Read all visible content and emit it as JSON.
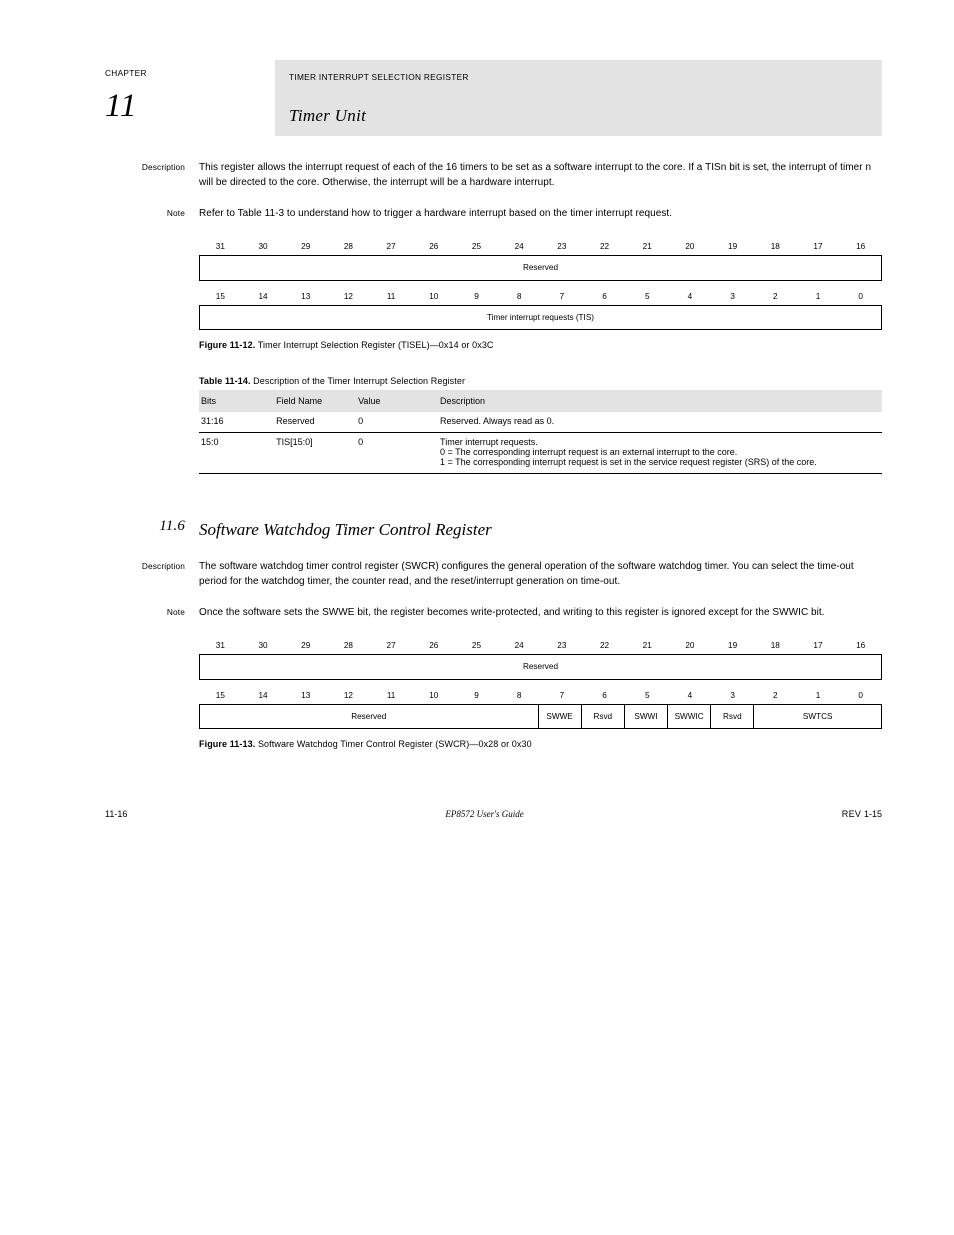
{
  "runhead": {
    "chapter_label": "CHAPTER",
    "chapter_num": "11",
    "sub": "TIMER INTERRUPT SELECTION REGISTER",
    "title": "Timer Unit"
  },
  "intro": {
    "desc_label": "Description",
    "desc_body": "This register allows the interrupt request of each of the 16 timers to be set as a software interrupt to the core. If a TISn bit is set, the interrupt of timer n will be directed to the core. Otherwise, the interrupt will be a hardware interrupt.",
    "note_label": "Note",
    "note_body": "Refer to Table 11-3 to understand how to trigger a hardware interrupt based on the timer interrupt request."
  },
  "fig1": {
    "bits_hi": [
      "31",
      "30",
      "29",
      "28",
      "27",
      "26",
      "25",
      "24",
      "23",
      "22",
      "21",
      "20",
      "19",
      "18",
      "17",
      "16"
    ],
    "field_hi": "Reserved",
    "bits_lo": [
      "15",
      "14",
      "13",
      "12",
      "11",
      "10",
      "9",
      "8",
      "7",
      "6",
      "5",
      "4",
      "3",
      "2",
      "1",
      "0"
    ],
    "field_lo": "Timer interrupt requests (TIS)",
    "cap_num": "Figure 11-12.",
    "cap_txt": "Timer Interrupt Selection Register (TISEL)—0x14 or 0x3C"
  },
  "tbl1": {
    "cap_num": "Table 11-14.",
    "cap_txt": "Description of the Timer Interrupt Selection Register",
    "h_bits": "Bits",
    "h_field": "Field Name",
    "h_value": "Value",
    "h_desc": "Description",
    "r0": {
      "bits": "31:16",
      "field": "Reserved",
      "value": "0",
      "desc": "Reserved. Always read as 0."
    },
    "r1": {
      "bits": "15:0",
      "field": "TIS[15:0]",
      "value": "0",
      "desc0": "Timer interrupt requests.",
      "desc1": "0 = The corresponding interrupt request is an external interrupt to the core.",
      "desc2": "1 = The corresponding interrupt request is set in the service request register (SRS) of the core."
    }
  },
  "sec2": {
    "title_ref": "11.6",
    "title_txt": "Software Watchdog Timer Control Register",
    "desc_label": "Description",
    "desc_body": "The software watchdog timer control register (SWCR) configures the general operation of the software watchdog timer. You can select the time-out period for the watchdog timer, the counter read, and the reset/interrupt generation on time-out.",
    "note_label": "Note",
    "note_body": "Once the software sets the SWWE bit, the register becomes write-protected, and writing to this register is ignored except for the SWWIC bit."
  },
  "fig2": {
    "bits_hi": [
      "31",
      "30",
      "29",
      "28",
      "27",
      "26",
      "25",
      "24",
      "23",
      "22",
      "21",
      "20",
      "19",
      "18",
      "17",
      "16"
    ],
    "field_hi": "Reserved",
    "bits_lo": [
      "15",
      "14",
      "13",
      "12",
      "11",
      "10",
      "9",
      "8",
      "7",
      "6",
      "5",
      "4",
      "3",
      "2",
      "1",
      "0"
    ],
    "lo_reserved": "Reserved",
    "lo_swwe": "SWWE",
    "lo_rsvd1": "Rsvd",
    "lo_swwi": "SWWI",
    "lo_swwic": "SWWIC",
    "lo_rsvd2": "Rsvd",
    "lo_swtcs": "SWTCS",
    "cap_num": "Figure 11-13.",
    "cap_txt": "Software Watchdog Timer Control Register (SWCR)—0x28 or 0x30"
  },
  "footer": {
    "left": "11-16",
    "center": "EP8572 User's Guide",
    "right_prefix": "REV ",
    "right_val": "1-15"
  }
}
